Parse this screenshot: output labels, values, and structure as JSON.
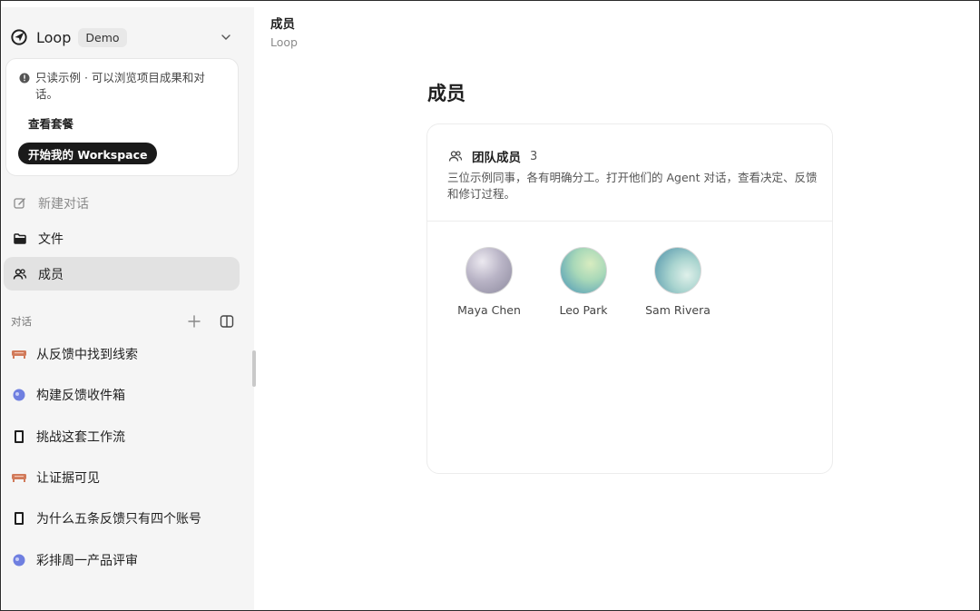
{
  "workspace": {
    "name": "Loop",
    "badge": "Demo"
  },
  "demo_card": {
    "notice": "只读示例 · 可以浏览项目成果和对话。",
    "plans_link": "查看套餐",
    "start_button": "开始我的 Workspace"
  },
  "nav": {
    "new_chat": "新建对话",
    "files": "文件",
    "members": "成员"
  },
  "conversations": {
    "section_label": "对话",
    "items": [
      {
        "label": "从反馈中找到线索",
        "icon": "sofa-icon",
        "color": "#d17a5a"
      },
      {
        "label": "构建反馈收件箱",
        "icon": "bubble-icon",
        "color": "#6f7fe0"
      },
      {
        "label": "挑战这套工作流",
        "icon": "doc-icon",
        "color": "#1f1f1f"
      },
      {
        "label": "让证据可见",
        "icon": "sofa-icon",
        "color": "#d17a5a"
      },
      {
        "label": "为什么五条反馈只有四个账号",
        "icon": "doc-icon",
        "color": "#1f1f1f"
      },
      {
        "label": "彩排周一产品评审",
        "icon": "bubble-icon",
        "color": "#6f7fe0"
      }
    ]
  },
  "header": {
    "title": "成员",
    "subtitle": "Loop"
  },
  "page": {
    "title": "成员"
  },
  "team_card": {
    "title": "团队成员",
    "count": "3",
    "description": "三位示例同事，各有明确分工。打开他们的 Agent 对话，查看决定、反馈和修订过程。",
    "members": [
      {
        "name": "Maya Chen"
      },
      {
        "name": "Leo Park"
      },
      {
        "name": "Sam Rivera"
      }
    ]
  }
}
